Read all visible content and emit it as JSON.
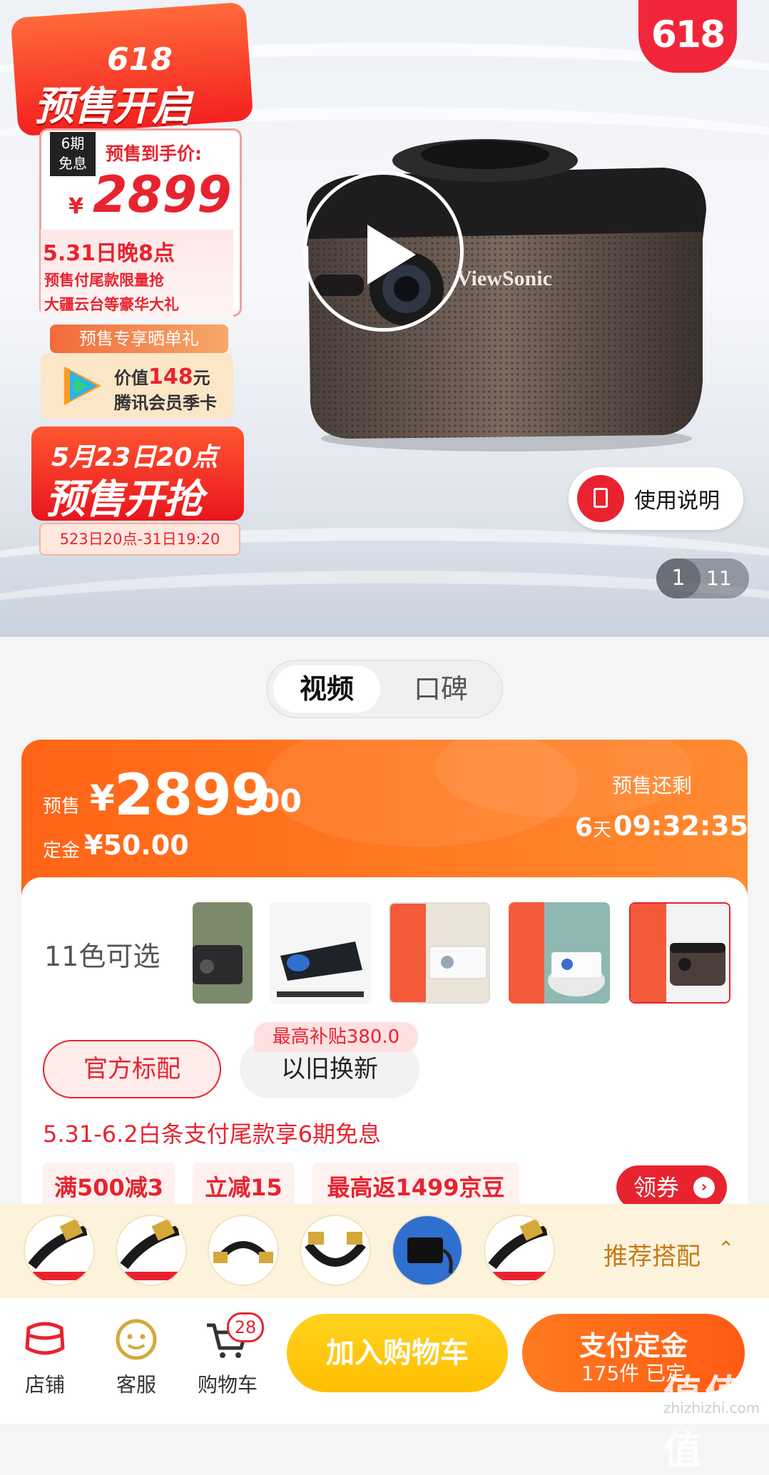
{
  "hero": {
    "badge_618": "618",
    "brand": "ViewSonic",
    "manual_label": "使用说明",
    "page_current": "1",
    "page_total": "11"
  },
  "poster": {
    "title_618": "618",
    "title": "预售开启",
    "installment_badge_line1": "6期",
    "installment_badge_line2": "免息",
    "price_label": "预售到手价:",
    "currency": "¥",
    "price": "2899",
    "date_line": "5.31日晚8点",
    "line2": "预售付尾款限量抢",
    "line3": "大疆云台等豪华大礼",
    "gift_pill": "预售专享晒单礼",
    "vip_line1_prefix": "价值",
    "vip_value": "148",
    "vip_line1_suffix": "元",
    "vip_line2": "腾讯会员季卡",
    "start_line1": "5月23日20点",
    "start_line2": "预售开抢",
    "range": "523日20点-31日19:20"
  },
  "tabs": {
    "video": "视频",
    "review": "口碑"
  },
  "price_card": {
    "presale_label": "预售",
    "currency": "¥",
    "price_int": "2899",
    "price_dec": ".00",
    "deposit_label": "定金",
    "deposit_value": "¥50.00",
    "remain_label": "预售还剩",
    "days": "6",
    "days_unit": "天",
    "time": "09:32:35"
  },
  "colors": {
    "label": "11色可选"
  },
  "options": {
    "official": "官方标配",
    "tradein": "以旧换新",
    "tradein_badge": "最高补贴380.0"
  },
  "promo_text": "5.31-6.2白条支付尾款享6期免息",
  "coupons": [
    "满500减3",
    "立减15",
    "最高返1499京豆"
  ],
  "coupon_button": "领券",
  "recommend": {
    "label": "推荐搭配",
    "caret": "⌃"
  },
  "bottom_nav": {
    "store": "店铺",
    "service": "客服",
    "cart": "购物车",
    "cart_count": "28"
  },
  "actions": {
    "add_to_cart": "加入购物车",
    "pay_deposit": "支付定金",
    "pay_sub": "175件 已定"
  },
  "watermark": {
    "text": "值值值",
    "url": "zhizhizhi.com"
  },
  "colors_theme": {
    "accent_red": "#e8232f",
    "orange": "#ff6a1a",
    "yellow": "#ffc800"
  }
}
